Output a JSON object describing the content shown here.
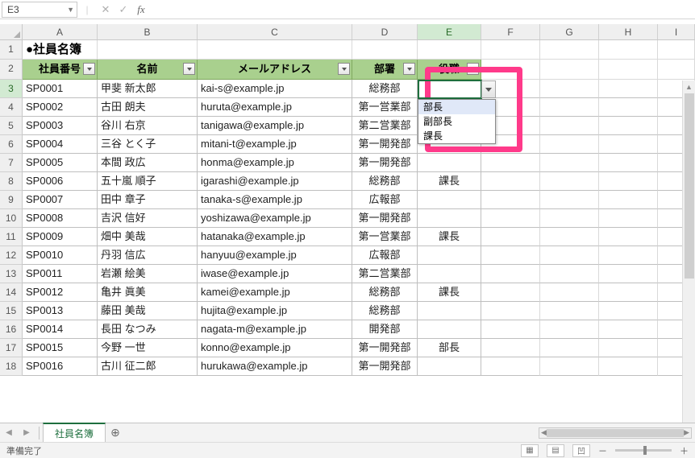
{
  "name_box": "E3",
  "columns": [
    "A",
    "B",
    "C",
    "D",
    "E",
    "F",
    "G",
    "H",
    "I"
  ],
  "active_col": "E",
  "active_row": 3,
  "title": "●社員名簿",
  "headers": {
    "a": "社員番号",
    "b": "名前",
    "c": "メールアドレス",
    "d": "部署",
    "e": "役職"
  },
  "dropdown": {
    "items": [
      "部長",
      "副部長",
      "課長"
    ]
  },
  "rows": [
    {
      "n": 3,
      "id": "SP0001",
      "name": "甲斐 新太郎",
      "mail": "kai-s@example.jp",
      "dept": "総務部",
      "role": ""
    },
    {
      "n": 4,
      "id": "SP0002",
      "name": "古田 朗夫",
      "mail": "huruta@example.jp",
      "dept": "第一営業部",
      "role": ""
    },
    {
      "n": 5,
      "id": "SP0003",
      "name": "谷川 右京",
      "mail": "tanigawa@example.jp",
      "dept": "第二営業部",
      "role": ""
    },
    {
      "n": 6,
      "id": "SP0004",
      "name": "三谷 とく子",
      "mail": "mitani-t@example.jp",
      "dept": "第一開発部",
      "role": ""
    },
    {
      "n": 7,
      "id": "SP0005",
      "name": "本間 政広",
      "mail": "honma@example.jp",
      "dept": "第一開発部",
      "role": ""
    },
    {
      "n": 8,
      "id": "SP0006",
      "name": "五十嵐 順子",
      "mail": "igarashi@example.jp",
      "dept": "総務部",
      "role": "課長"
    },
    {
      "n": 9,
      "id": "SP0007",
      "name": "田中 章子",
      "mail": "tanaka-s@example.jp",
      "dept": "広報部",
      "role": ""
    },
    {
      "n": 10,
      "id": "SP0008",
      "name": "吉沢 信好",
      "mail": "yoshizawa@example.jp",
      "dept": "第一開発部",
      "role": ""
    },
    {
      "n": 11,
      "id": "SP0009",
      "name": "畑中 美哉",
      "mail": "hatanaka@example.jp",
      "dept": "第一営業部",
      "role": "課長"
    },
    {
      "n": 12,
      "id": "SP0010",
      "name": "丹羽 信広",
      "mail": "hanyuu@example.jp",
      "dept": "広報部",
      "role": ""
    },
    {
      "n": 13,
      "id": "SP0011",
      "name": "岩瀬 絵美",
      "mail": "iwase@example.jp",
      "dept": "第二営業部",
      "role": ""
    },
    {
      "n": 14,
      "id": "SP0012",
      "name": "亀井 眞美",
      "mail": "kamei@example.jp",
      "dept": "総務部",
      "role": "課長"
    },
    {
      "n": 15,
      "id": "SP0013",
      "name": "藤田 美哉",
      "mail": "hujita@example.jp",
      "dept": "総務部",
      "role": ""
    },
    {
      "n": 16,
      "id": "SP0014",
      "name": "長田 なつみ",
      "mail": "nagata-m@example.jp",
      "dept": "開発部",
      "role": ""
    },
    {
      "n": 17,
      "id": "SP0015",
      "name": "今野 一世",
      "mail": "konno@example.jp",
      "dept": "第一開発部",
      "role": "部長"
    },
    {
      "n": 18,
      "id": "SP0016",
      "name": "古川 征二郎",
      "mail": "hurukawa@example.jp",
      "dept": "第一開発部",
      "role": ""
    }
  ],
  "sheet_tab": "社員名簿",
  "status": "準備完了",
  "fx_label": "fx",
  "cancel_glyph": "✕",
  "confirm_glyph": "✓",
  "plus_glyph": "＋",
  "minus_glyph": "－"
}
